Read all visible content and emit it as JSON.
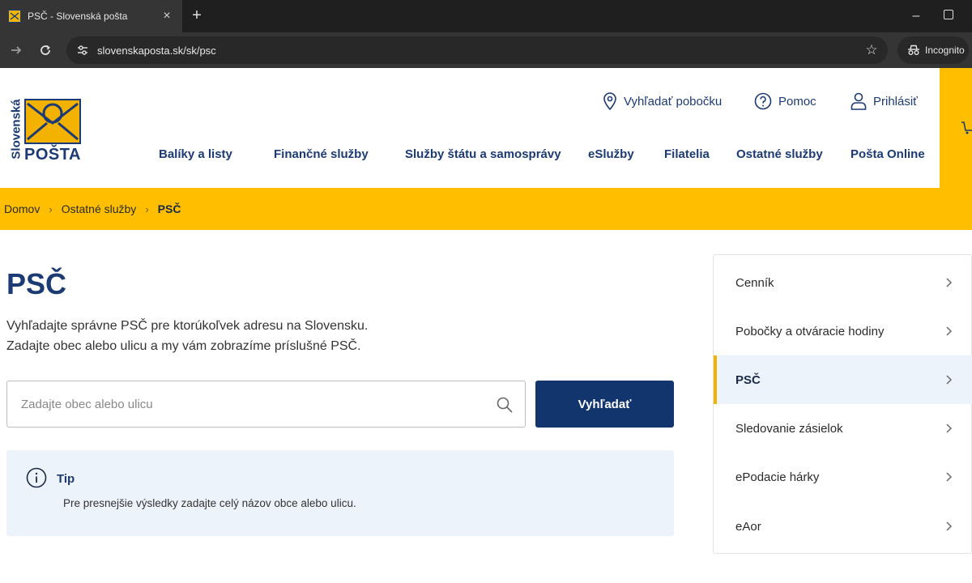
{
  "browser": {
    "tab_title": "PSČ - Slovenská pošta",
    "url": "slovenskaposta.sk/sk/psc",
    "incognito_label": "Incognito"
  },
  "logo": {
    "top_word": "Slovenská",
    "bottom_word": "POŠTA"
  },
  "top_links": {
    "branch": "Vyhľadať pobočku",
    "help": "Pomoc",
    "login": "Prihlásiť"
  },
  "main_nav": [
    "Balíky a listy",
    "Finančné služby",
    "Služby štátu a samosprávy",
    "eSlužby",
    "Filatelia",
    "Ostatné služby",
    "Pošta Online"
  ],
  "breadcrumb": [
    "Domov",
    "Ostatné služby",
    "PSČ"
  ],
  "page": {
    "title": "PSČ",
    "intro_line1": "Vyhľadajte správne PSČ pre ktorúkoľvek adresu na Slovensku.",
    "intro_line2": "Zadajte obec alebo ulicu a my vám zobrazíme príslušné PSČ.",
    "search_placeholder": "Zadajte obec alebo ulicu",
    "search_value": "",
    "search_button": "Vyhľadať",
    "tip_title": "Tip",
    "tip_text": "Pre presnejšie výsledky zadajte celý názov obce alebo ulicu."
  },
  "sidebar": [
    {
      "label": "Cenník",
      "active": false
    },
    {
      "label": "Pobočky a otváracie hodiny",
      "active": false
    },
    {
      "label": "PSČ",
      "active": true
    },
    {
      "label": "Sledovanie zásielok",
      "active": false
    },
    {
      "label": "ePodacie hárky",
      "active": false
    },
    {
      "label": "eAor",
      "active": false
    }
  ],
  "colors": {
    "brand_yellow": "#ffbf00",
    "brand_blue": "#13356d",
    "tip_background": "#ecf3fb"
  }
}
